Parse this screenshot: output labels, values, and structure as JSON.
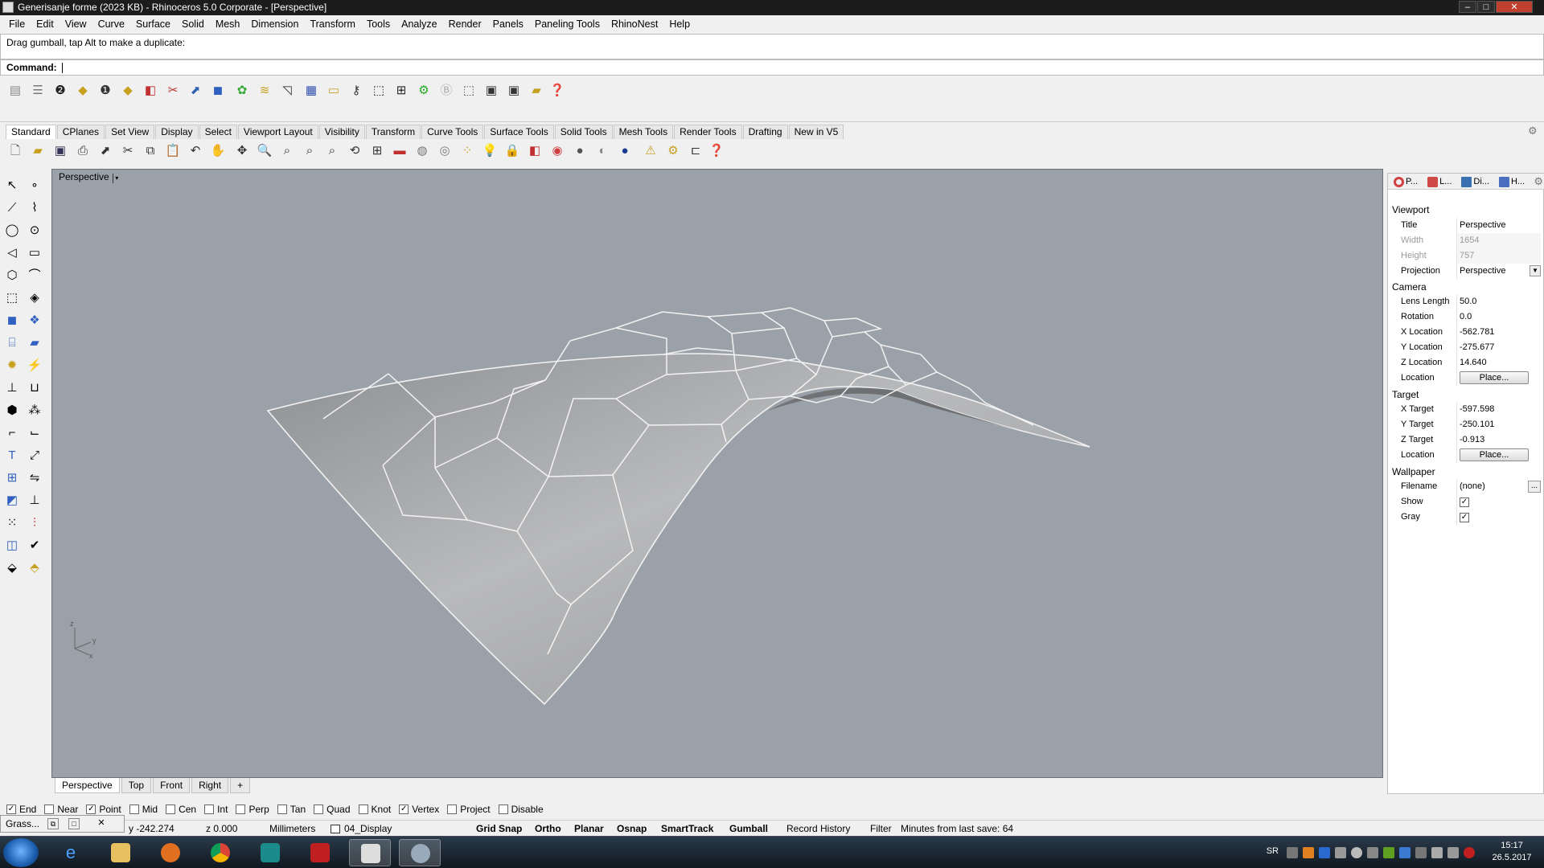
{
  "window": {
    "title": "Generisanje forme (2023 KB) - Rhinoceros  5.0 Corporate - [Perspective]",
    "btn_min": "–",
    "btn_max": "□",
    "btn_close": "✕"
  },
  "menu": [
    "File",
    "Edit",
    "View",
    "Curve",
    "Surface",
    "Solid",
    "Mesh",
    "Dimension",
    "Transform",
    "Tools",
    "Analyze",
    "Render",
    "Panels",
    "Paneling Tools",
    "RhinoNest",
    "Help"
  ],
  "command": {
    "history": "Drag gumball, tap Alt to make a duplicate:",
    "prompt": "Command:",
    "value": ""
  },
  "toolbar_tabs": [
    "Standard",
    "CPlanes",
    "Set View",
    "Display",
    "Select",
    "Viewport Layout",
    "Visibility",
    "Transform",
    "Curve Tools",
    "Surface Tools",
    "Solid Tools",
    "Mesh Tools",
    "Render Tools",
    "Drafting",
    "New in V5"
  ],
  "viewport": {
    "title": "Perspective",
    "dropdown": "▾",
    "axis_z": "z",
    "axis_y": "y",
    "axis_x": "x"
  },
  "viewport_tabs": [
    "Perspective",
    "Top",
    "Front",
    "Right",
    "+"
  ],
  "panel": {
    "tabs": [
      {
        "label": "P...",
        "color": "#d04040"
      },
      {
        "label": "L...",
        "color": "#d04848"
      },
      {
        "label": "Di...",
        "color": "#3a6fb0"
      },
      {
        "label": "H...",
        "color": "#4a6fc0"
      }
    ],
    "sections": {
      "viewport": "Viewport",
      "camera": "Camera",
      "target": "Target",
      "wallpaper": "Wallpaper"
    },
    "viewport_rows": [
      {
        "key": "Title",
        "value": "Perspective"
      },
      {
        "key": "Width",
        "value": "1654"
      },
      {
        "key": "Height",
        "value": "757"
      },
      {
        "key": "Projection",
        "value": "Perspective"
      }
    ],
    "camera_rows": [
      {
        "key": "Lens Length",
        "value": "50.0"
      },
      {
        "key": "Rotation",
        "value": "0.0"
      },
      {
        "key": "X Location",
        "value": "-562.781"
      },
      {
        "key": "Y Location",
        "value": "-275.677"
      },
      {
        "key": "Z Location",
        "value": "14.640"
      },
      {
        "key": "Location",
        "value": "Place..."
      }
    ],
    "target_rows": [
      {
        "key": "X Target",
        "value": "-597.598"
      },
      {
        "key": "Y Target",
        "value": "-250.101"
      },
      {
        "key": "Z Target",
        "value": "-0.913"
      },
      {
        "key": "Location",
        "value": "Place..."
      }
    ],
    "wallpaper_rows": [
      {
        "key": "Filename",
        "value": "(none)",
        "btn": "..."
      },
      {
        "key": "Show",
        "checked": true
      },
      {
        "key": "Gray",
        "checked": true
      }
    ]
  },
  "osnaps": [
    {
      "label": "End",
      "checked": true
    },
    {
      "label": "Near",
      "checked": false
    },
    {
      "label": "Point",
      "checked": true
    },
    {
      "label": "Mid",
      "checked": false
    },
    {
      "label": "Cen",
      "checked": false
    },
    {
      "label": "Int",
      "checked": false
    },
    {
      "label": "Perp",
      "checked": false
    },
    {
      "label": "Tan",
      "checked": false
    },
    {
      "label": "Quad",
      "checked": false
    },
    {
      "label": "Knot",
      "checked": false
    },
    {
      "label": "Vertex",
      "checked": true
    },
    {
      "label": "Project",
      "checked": false
    },
    {
      "label": "Disable",
      "checked": false
    }
  ],
  "status": {
    "y": "y -242.274",
    "z": "z 0.000",
    "units": "Millimeters",
    "layer": "04_Display",
    "grid_snap": "Grid Snap",
    "ortho": "Ortho",
    "planar": "Planar",
    "osnap": "Osnap",
    "smarttrack": "SmartTrack",
    "gumball": "Gumball",
    "record_history": "Record History",
    "filter": "Filter",
    "save_info": "Minutes from last save: 64"
  },
  "grasshopper": {
    "label": "Grass..."
  },
  "taskbar": {
    "lang": "SR",
    "time": "15:17",
    "date": "26.5.2017"
  }
}
